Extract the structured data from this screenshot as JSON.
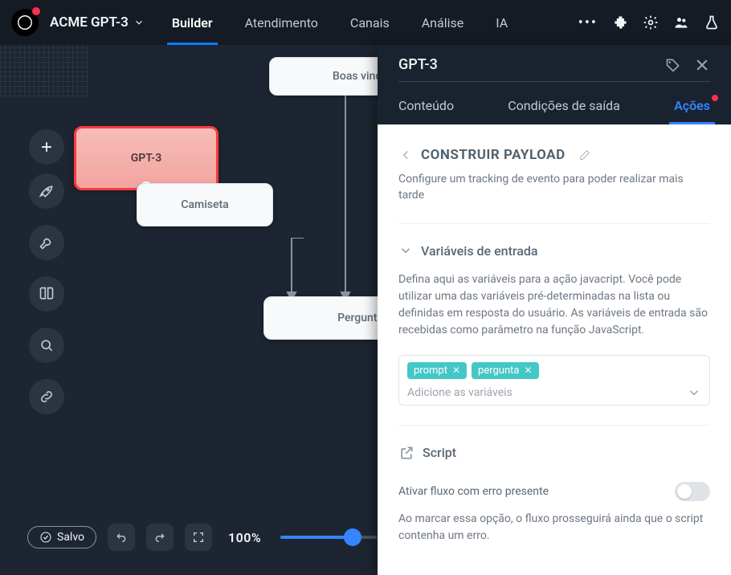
{
  "topbar": {
    "workspace_name": "ACME GPT-3",
    "tabs": {
      "builder": "Builder",
      "atendimento": "Atendimento",
      "canais": "Canais",
      "analise": "Análise",
      "ia": "IA"
    }
  },
  "nodes": {
    "welcome": "Boas vindas",
    "gpt3": "GPT-3",
    "camiseta": "Camiseta",
    "pergunta": "Pergunta"
  },
  "bottom": {
    "saved": "Salvo",
    "zoom": "100%"
  },
  "panel": {
    "title": "GPT-3",
    "tabs": {
      "conteudo": "Conteúdo",
      "condicoes": "Condições de saída",
      "acoes": "Ações"
    },
    "action": {
      "heading": "CONSTRUIR PAYLOAD",
      "subheading": "Configure um tracking de evento para poder realizar mais tarde"
    },
    "variables": {
      "title": "Variáveis de entrada",
      "desc": "Defina aqui as variáveis para a ação javacript. Você pode utilizar uma das variáveis pré-determinadas na lista ou definidas em resposta do usuário. As variáveis de entrada são recebidas como parâmetro na função JavaScript.",
      "tags": {
        "prompt": "prompt",
        "pergunta": "pergunta"
      },
      "placeholder": "Adicione as variáveis"
    },
    "script": {
      "title": "Script",
      "toggle_label": "Ativar fluxo com erro presente",
      "toggle_desc": "Ao marcar essa opção, o fluxo prosseguirá ainda que o script contenha um erro."
    }
  }
}
